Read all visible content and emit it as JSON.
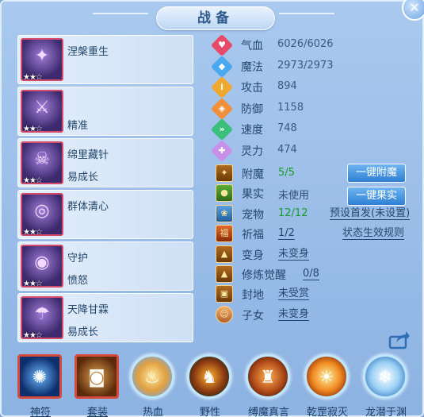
{
  "title": "战备",
  "skills": [
    {
      "name": "涅槃重生",
      "sub": "",
      "stars": "★★☆"
    },
    {
      "name": "",
      "sub": "精准",
      "stars": "★★☆"
    },
    {
      "name": "绵里藏针",
      "sub": "易成长",
      "stars": "★★☆"
    },
    {
      "name": "群体清心",
      "sub": "",
      "stars": "★★☆"
    },
    {
      "name": "守护",
      "sub": "愤怒",
      "stars": "★★☆"
    },
    {
      "name": "天降甘霖",
      "sub": "易成长",
      "stars": "★★☆"
    }
  ],
  "stats": [
    {
      "label": "气血",
      "value": "6026/6026",
      "icon": "heart-icon",
      "color": "#e84a6a"
    },
    {
      "label": "魔法",
      "value": "2973/2973",
      "icon": "mana-icon",
      "color": "#4aa8f0"
    },
    {
      "label": "攻击",
      "value": "894",
      "icon": "attack-icon",
      "color": "#f0a830"
    },
    {
      "label": "防御",
      "value": "1158",
      "icon": "defense-icon",
      "color": "#f0903a"
    },
    {
      "label": "速度",
      "value": "748",
      "icon": "speed-icon",
      "color": "#3ac07a"
    },
    {
      "label": "灵力",
      "value": "474",
      "icon": "spirit-icon",
      "color": "#c890e8"
    }
  ],
  "attrs": {
    "fumo": {
      "label": "附魔",
      "value": "5/5"
    },
    "guoshi": {
      "label": "果实",
      "value": "未使用"
    },
    "chongwu": {
      "label": "宠物",
      "value": "12/12"
    },
    "qifu": {
      "label": "祈福",
      "value": "1/2"
    },
    "bianshen": {
      "label": "变身",
      "value": "未变身"
    },
    "xiulian": {
      "label": "修炼觉醒",
      "value": "0/8"
    },
    "fengdi": {
      "label": "封地",
      "value": "未受赏"
    },
    "zinv": {
      "label": "子女",
      "value": "未变身"
    }
  },
  "buttons": {
    "fumo": "一键附魔",
    "guoshi": "一键果实"
  },
  "links": {
    "preset": "预设首发(未设置)",
    "rule": "状态生效规则"
  },
  "bottom": [
    {
      "label": "神符",
      "icon": "rune-icon",
      "style": "square"
    },
    {
      "label": "套装",
      "icon": "suit-icon",
      "style": "square"
    },
    {
      "label": "热血",
      "icon": "hot-blood-icon",
      "style": "round"
    },
    {
      "label": "野性",
      "icon": "wild-icon",
      "style": "round"
    },
    {
      "label": "缚魔真言",
      "icon": "seal-mantra-icon",
      "style": "round"
    },
    {
      "label": "乾罡寂灭",
      "icon": "qiangang-icon",
      "style": "round"
    },
    {
      "label": "龙潜于渊",
      "icon": "dragon-icon",
      "style": "round"
    }
  ]
}
